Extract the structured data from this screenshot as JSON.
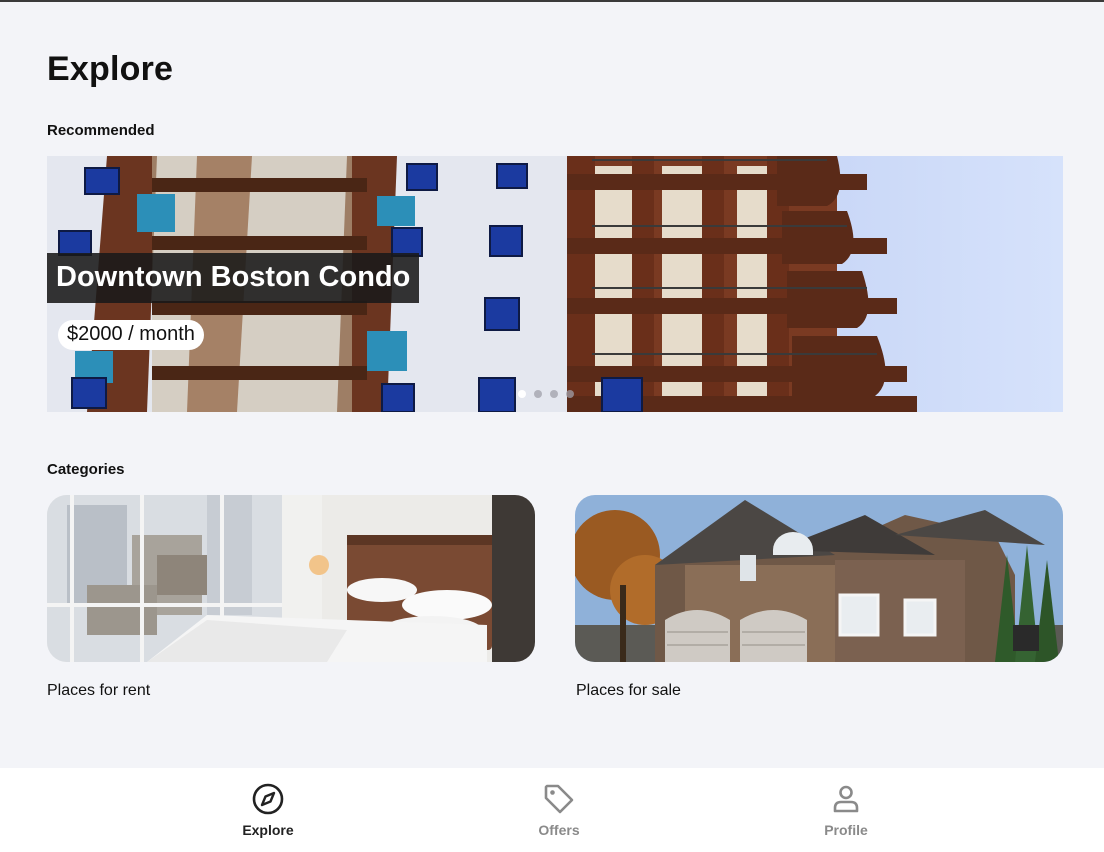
{
  "page": {
    "title": "Explore"
  },
  "sections": {
    "recommended": "Recommended",
    "categories": "Categories"
  },
  "recommended": {
    "title": "Downtown Boston Condo",
    "price": "$2000 / month",
    "slides_total": 4,
    "active_slide": 1
  },
  "categories": [
    {
      "label": "Places for rent"
    },
    {
      "label": "Places for sale"
    }
  ],
  "bottom_nav": {
    "items": [
      {
        "label": "Explore",
        "icon": "compass-icon",
        "active": true
      },
      {
        "label": "Offers",
        "icon": "tag-icon",
        "active": false
      },
      {
        "label": "Profile",
        "icon": "person-icon",
        "active": false
      }
    ]
  },
  "colors": {
    "background": "#f3f4f8",
    "text": "#111111",
    "nav_active": "#222222",
    "nav_inactive": "#8a8a8a"
  }
}
